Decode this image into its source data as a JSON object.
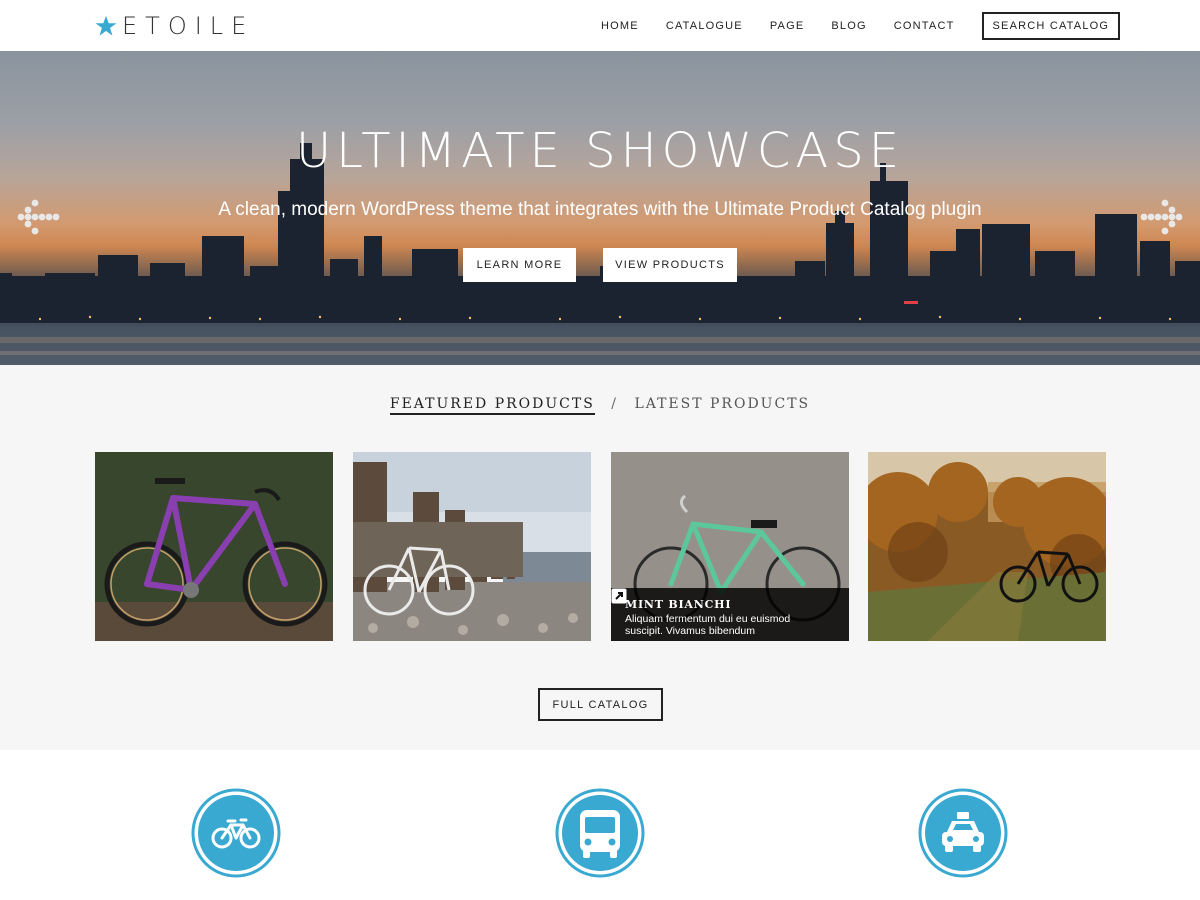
{
  "brand": {
    "name": "ETOILE",
    "star_color": "#3aa9d1"
  },
  "nav": {
    "items": [
      "HOME",
      "CATALOGUE",
      "PAGE",
      "BLOG",
      "CONTACT"
    ],
    "search_label": "SEARCH CATALOG"
  },
  "hero": {
    "title": "ULTIMATE SHOWCASE",
    "subtitle": "A clean, modern WordPress theme that integrates with the Ultimate Product Catalog plugin",
    "learn_more_label": "LEARN MORE",
    "view_products_label": "VIEW PRODUCTS"
  },
  "products": {
    "tab_featured": "FEATURED PRODUCTS",
    "tab_separator": "/",
    "tab_latest": "LATEST PRODUCTS",
    "cards": [
      {
        "image": "purple-road-bike"
      },
      {
        "image": "white-bike-beach"
      },
      {
        "image": "mint-bianchi-bike",
        "title": "MINT BIANCHI",
        "description": "Aliquam fermentum dui eu euismod suscipit. Vivamus bibendum"
      },
      {
        "image": "mountain-bike-autumn"
      }
    ],
    "full_catalog_label": "FULL CATALOG"
  },
  "features": {
    "icons": [
      "bicycle-icon",
      "bus-icon",
      "taxi-icon"
    ],
    "accent": "#3aa9d1"
  }
}
